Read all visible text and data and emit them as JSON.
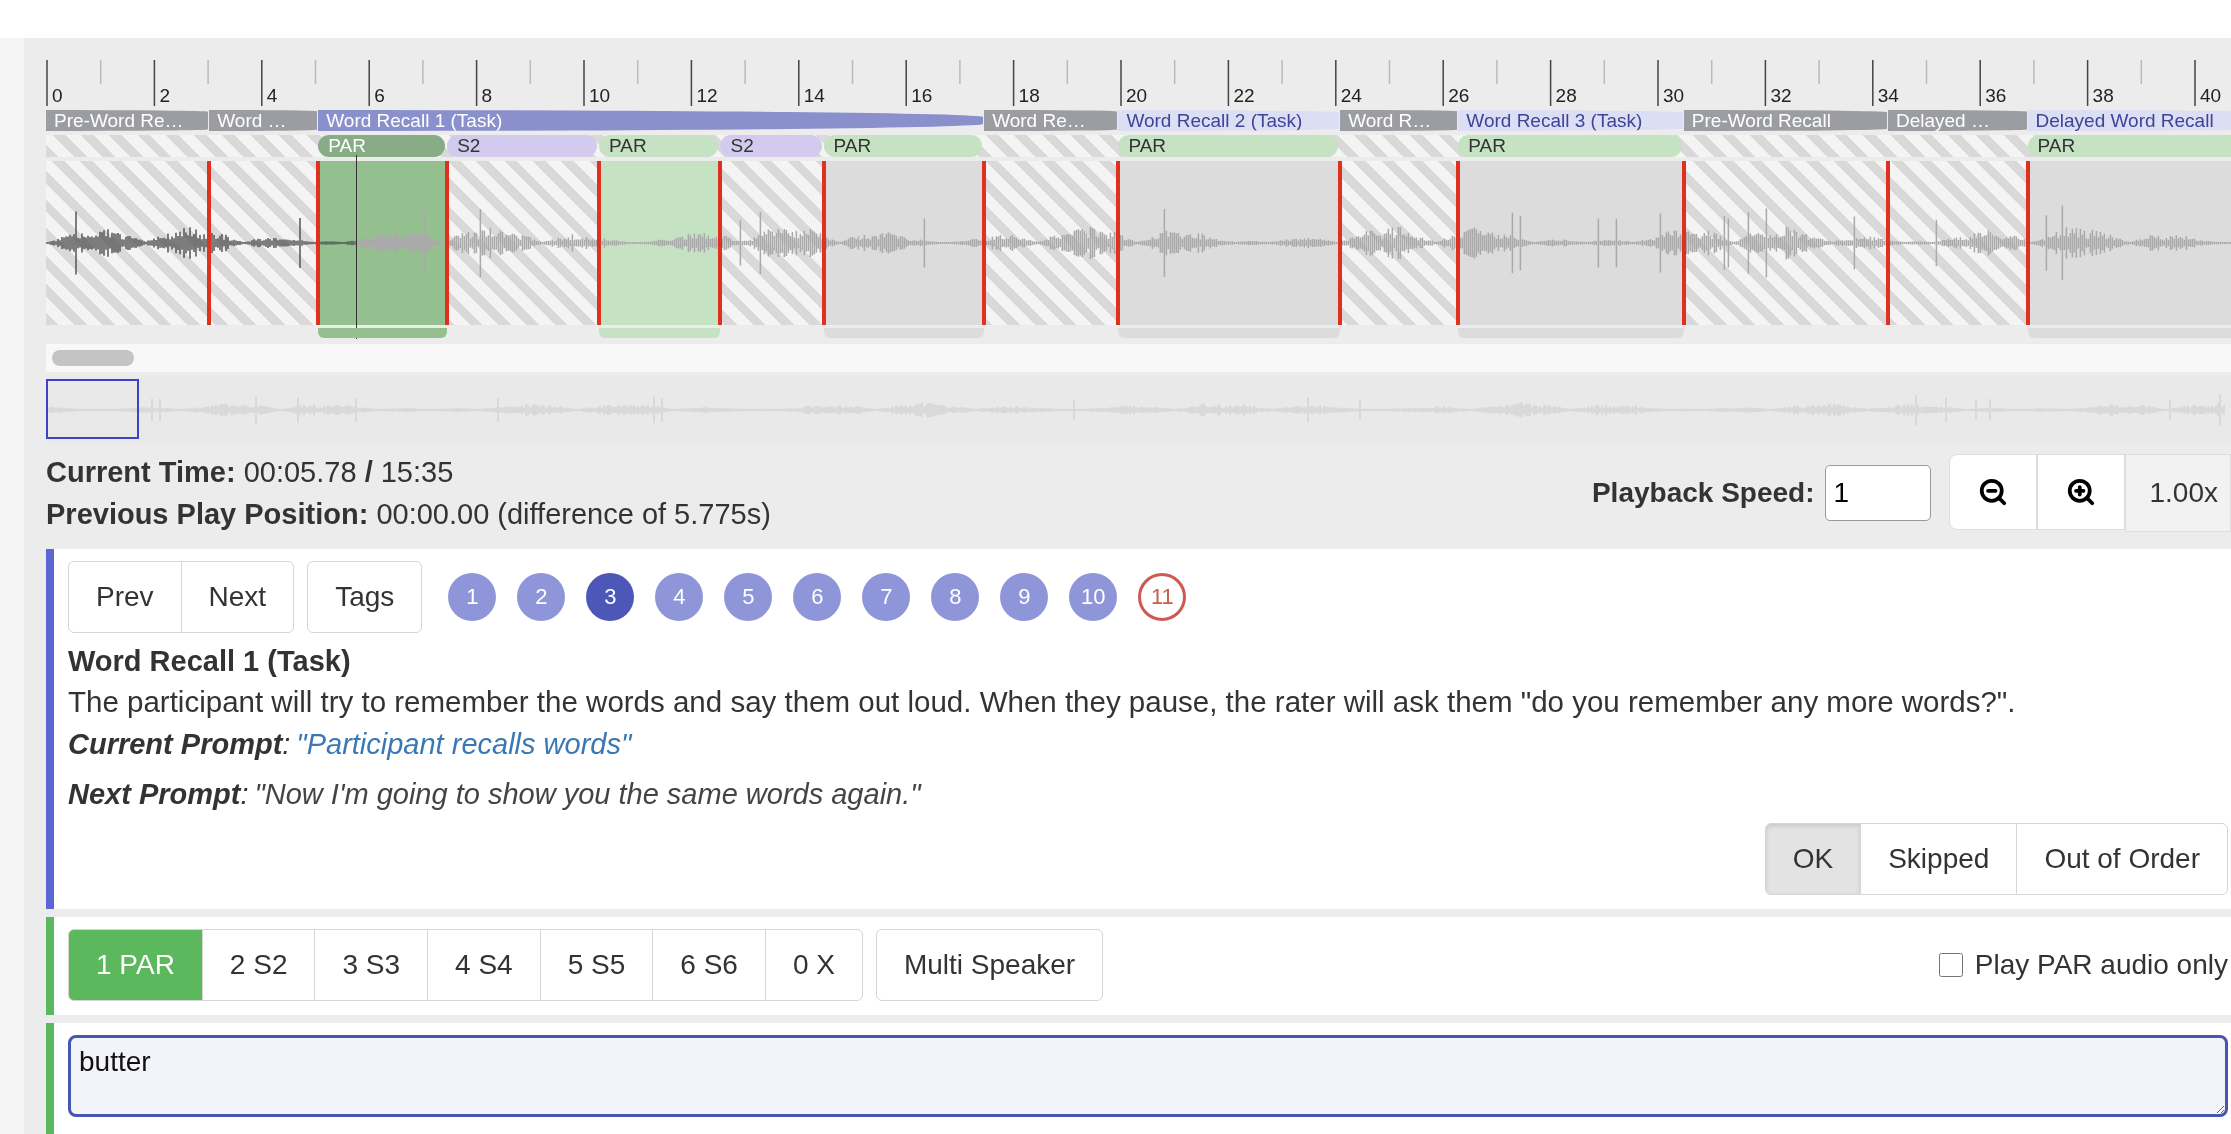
{
  "timeline": {
    "ruler": [
      "0",
      "2",
      "4",
      "6",
      "8",
      "10",
      "12",
      "14",
      "16",
      "18",
      "20",
      "22",
      "24",
      "26",
      "28",
      "30",
      "32",
      "34",
      "36",
      "38",
      "40"
    ],
    "tasks": [
      {
        "label": "Pre-Word Re…",
        "kind": "other",
        "selected": false
      },
      {
        "label": "Word …",
        "kind": "other",
        "selected": false
      },
      {
        "label": "Word Recall 1 (Task)",
        "kind": "task",
        "selected": true
      },
      {
        "label": "Word Re…",
        "kind": "other",
        "selected": false
      },
      {
        "label": "Word Recall 2 (Task)",
        "kind": "task",
        "selected": false
      },
      {
        "label": "Word R…",
        "kind": "other",
        "selected": false
      },
      {
        "label": "Word Recall 3 (Task)",
        "kind": "task",
        "selected": false
      },
      {
        "label": "Pre-Word Recall",
        "kind": "other",
        "selected": false
      },
      {
        "label": "Delayed …",
        "kind": "other",
        "selected": false
      },
      {
        "label": "Delayed Word Recall",
        "kind": "task",
        "selected": false
      }
    ],
    "speakers": [
      {
        "label": "PAR",
        "kind": "par",
        "selected": true
      },
      {
        "label": "S2",
        "kind": "s2",
        "selected": false
      },
      {
        "label": "PAR",
        "kind": "par",
        "selected": false
      },
      {
        "label": "S2",
        "kind": "s2",
        "selected": false
      },
      {
        "label": "PAR",
        "kind": "par",
        "selected": false
      },
      {
        "label": "PAR",
        "kind": "par",
        "selected": false
      },
      {
        "label": "PAR",
        "kind": "par",
        "selected": false
      },
      {
        "label": "PAR",
        "kind": "par",
        "selected": false
      }
    ],
    "regions": [
      {
        "kind": "selected"
      },
      {
        "kind": "active"
      },
      {
        "kind": "inactive"
      },
      {
        "kind": "inactive"
      },
      {
        "kind": "inactive"
      },
      {
        "kind": "inactive"
      }
    ]
  },
  "status": {
    "current_label": "Current Time:",
    "current_value": "00:05.78 **/** 15:35",
    "previous_label": "Previous Play Position:",
    "previous_value": "00:00.00 (difference of 5.775s)"
  },
  "playback": {
    "label": "Playback Speed:",
    "value": "1",
    "rate": "1.00x"
  },
  "section": {
    "nav": [
      "Prev",
      "Next"
    ],
    "tags": "Tags",
    "steps": [
      {
        "label": "1",
        "kind": "normal",
        "selected": false
      },
      {
        "label": "2",
        "kind": "normal",
        "selected": false
      },
      {
        "label": "3",
        "kind": "normal",
        "selected": true
      },
      {
        "label": "4",
        "kind": "normal",
        "selected": false
      },
      {
        "label": "5",
        "kind": "normal",
        "selected": false
      },
      {
        "label": "6",
        "kind": "normal",
        "selected": false
      },
      {
        "label": "7",
        "kind": "normal",
        "selected": false
      },
      {
        "label": "8",
        "kind": "normal",
        "selected": false
      },
      {
        "label": "9",
        "kind": "normal",
        "selected": false
      },
      {
        "label": "10",
        "kind": "normal",
        "selected": false
      },
      {
        "label": "11",
        "kind": "flagged",
        "selected": false
      }
    ],
    "title": "Word Recall 1 (Task)",
    "description": "The participant will try to remember the words and say them out loud. When they pause, the rater will ask them \"do you remember any more words?\".",
    "prompts": [
      {
        "label": "**Current Prompt**:",
        "text": "\"Participant recalls words\"",
        "kind": "current"
      },
      {
        "label": "**Next Prompt**:",
        "text": "\"Now I'm going to show you the same words again.\"",
        "kind": "next"
      }
    ],
    "statuses": [
      {
        "label": "OK",
        "selected": true
      },
      {
        "label": "Skipped",
        "selected": false
      },
      {
        "label": "Out of Order",
        "selected": false
      }
    ]
  },
  "speaker_bar": {
    "speakers": [
      {
        "label": "1 PAR",
        "selected": true
      },
      {
        "label": "2 S2",
        "selected": false
      },
      {
        "label": "3 S3",
        "selected": false
      },
      {
        "label": "4 S4",
        "selected": false
      },
      {
        "label": "5 S5",
        "selected": false
      },
      {
        "label": "6 S6",
        "selected": false
      },
      {
        "label": "0 X",
        "selected": false
      }
    ],
    "multi": "Multi Speaker",
    "par_only": {
      "label": "Play PAR audio only",
      "checked": false
    }
  },
  "transcript": {
    "value": "butter"
  }
}
